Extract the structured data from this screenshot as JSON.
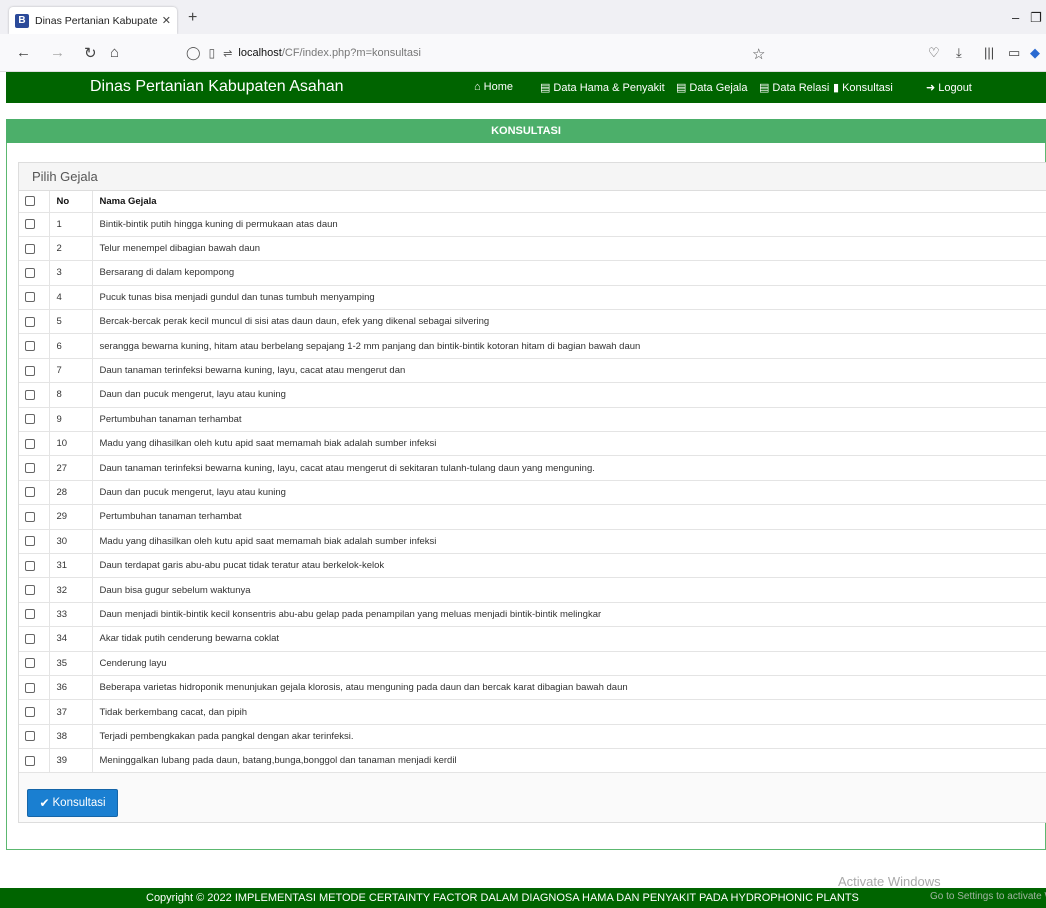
{
  "browser": {
    "tab_title": "Dinas Pertanian Kabupaten Asahan",
    "url_host": "localhost",
    "url_path": "/CF/index.php?m=konsultasi"
  },
  "header": {
    "brand": "Dinas Pertanian Kabupaten Asahan",
    "menu": [
      {
        "label": "Home",
        "icon": "home-icon"
      },
      {
        "label": "Data Hama & Penyakit",
        "icon": "list-icon"
      },
      {
        "label": "Data Gejala",
        "icon": "list-icon"
      },
      {
        "label": "Data Relasi",
        "icon": "list-icon"
      },
      {
        "label": "Konsultasi",
        "icon": "bar-chart-icon"
      },
      {
        "label": "Logout",
        "icon": "logout-icon"
      }
    ]
  },
  "panel": {
    "title": "KONSULTASI",
    "subheading": "Pilih Gejala",
    "columns": [
      "No",
      "Nama Gejala"
    ],
    "rows": [
      {
        "no": "1",
        "gejala": "Bintik-bintik putih hingga kuning di permukaan atas daun"
      },
      {
        "no": "2",
        "gejala": "Telur menempel dibagian bawah daun"
      },
      {
        "no": "3",
        "gejala": "Bersarang di dalam kepompong"
      },
      {
        "no": "4",
        "gejala": "Pucuk tunas bisa menjadi gundul dan tunas tumbuh menyamping"
      },
      {
        "no": "5",
        "gejala": "Bercak-bercak perak kecil muncul di sisi atas daun daun, efek yang dikenal sebagai silvering"
      },
      {
        "no": "6",
        "gejala": "serangga bewarna kuning, hitam atau berbelang sepajang 1-2 mm panjang dan bintik-bintik kotoran hitam di bagian bawah daun"
      },
      {
        "no": "7",
        "gejala": "Daun tanaman terinfeksi bewarna kuning, layu, cacat atau mengerut dan"
      },
      {
        "no": "8",
        "gejala": "Daun dan pucuk mengerut, layu atau kuning"
      },
      {
        "no": "9",
        "gejala": "Pertumbuhan tanaman terhambat"
      },
      {
        "no": "10",
        "gejala": "Madu yang dihasilkan oleh kutu apid saat memamah biak adalah sumber infeksi"
      },
      {
        "no": "27",
        "gejala": "Daun tanaman terinfeksi bewarna kuning, layu, cacat atau mengerut di sekitaran tulanh-tulang daun yang menguning."
      },
      {
        "no": "28",
        "gejala": "Daun dan pucuk mengerut, layu atau kuning"
      },
      {
        "no": "29",
        "gejala": "Pertumbuhan tanaman terhambat"
      },
      {
        "no": "30",
        "gejala": "Madu yang dihasilkan oleh kutu apid saat memamah biak adalah sumber infeksi"
      },
      {
        "no": "31",
        "gejala": "Daun terdapat garis abu-abu pucat tidak teratur atau berkelok-kelok"
      },
      {
        "no": "32",
        "gejala": "Daun bisa gugur sebelum waktunya"
      },
      {
        "no": "33",
        "gejala": "Daun menjadi bintik-bintik kecil konsentris abu-abu gelap pada penampilan yang meluas menjadi bintik-bintik melingkar"
      },
      {
        "no": "34",
        "gejala": "Akar tidak putih cenderung bewarna coklat"
      },
      {
        "no": "35",
        "gejala": "Cenderung layu"
      },
      {
        "no": "36",
        "gejala": "Beberapa varietas hidroponik menunjukan gejala klorosis, atau menguning pada daun dan bercak karat dibagian bawah daun"
      },
      {
        "no": "37",
        "gejala": "Tidak berkembang cacat, dan pipih"
      },
      {
        "no": "38",
        "gejala": "Terjadi pembengkakan pada pangkal dengan akar terinfeksi."
      },
      {
        "no": "39",
        "gejala": "Meninggalkan lubang pada daun, batang,bunga,bonggol dan tanaman menjadi kerdil"
      }
    ],
    "submit_label": "Konsultasi"
  },
  "footer": {
    "text": "Copyright © 2022 IMPLEMENTASI METODE CERTAINTY FACTOR DALAM DIAGNOSA HAMA DAN PENYAKIT PADA HYDROPHONIC PLANTS"
  },
  "watermark": {
    "line1": "Activate Windows",
    "line2": "Go to Settings to activate Windows."
  }
}
